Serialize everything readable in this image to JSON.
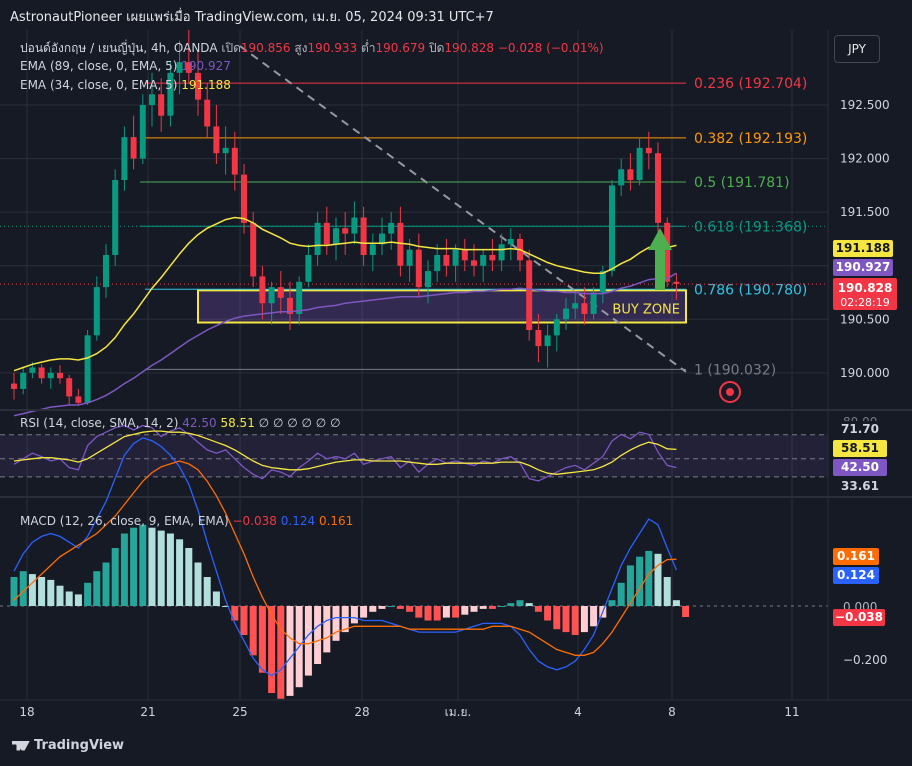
{
  "header": {
    "publisher": "AstronautPioneer เผยแพร่เมื่อ TradingView.com, เม.ย. 05, 2024 09:31 UTC+7"
  },
  "symbol_line": {
    "name": "ปอนด์อังกฤษ / เยนญี่ปุ่น, 4h, OANDA",
    "open_label": "เปิด",
    "open": "190.856",
    "high_label": "สูง",
    "high": "190.933",
    "low_label": "ต่ำ",
    "low": "190.679",
    "close_label": "ปิด",
    "close": "190.828",
    "change": "−0.028 (−0.01%)"
  },
  "ema_legend": [
    {
      "label": "EMA (89, close, 0, EMA, 5)",
      "value": "190.927",
      "color": "#7e57c2"
    },
    {
      "label": "EMA (34, close, 0, EMA, 5)",
      "value": "191.188",
      "color": "#f5e642"
    }
  ],
  "currency_button": "JPY",
  "chart_data": {
    "type": "candlestick",
    "symbol": "GBPJPY",
    "timeframe": "4h",
    "y_axis_ticks": [
      "192.500",
      "192.000",
      "191.500",
      "191.000",
      "190.500",
      "190.000"
    ],
    "x_axis_ticks": [
      "18",
      "21",
      "25",
      "28",
      "เม.ย.",
      "4",
      "8",
      "11"
    ],
    "ylim": [
      189.7,
      193.2
    ],
    "fibonacci": [
      {
        "level": "0.236",
        "price": "192.704",
        "label": "0.236 (192.704)",
        "color": "#f23645"
      },
      {
        "level": "0.382",
        "price": "192.193",
        "label": "0.382 (192.193)",
        "color": "#ff9800"
      },
      {
        "level": "0.5",
        "price": "191.781",
        "label": "0.5 (191.781)",
        "color": "#4caf50"
      },
      {
        "level": "0.618",
        "price": "191.368",
        "label": "0.618 (191.368)",
        "color": "#089981"
      },
      {
        "level": "0.786",
        "price": "190.780",
        "label": "0.786 (190.780)",
        "color": "#2ec4e0"
      },
      {
        "level": "1",
        "price": "190.032",
        "label": "1 (190.032)",
        "color": "#787b86"
      }
    ],
    "buy_zone": {
      "label": "BUY ZONE",
      "top": 190.77,
      "bottom": 190.47,
      "color": "#f5e642"
    },
    "price_tags": [
      {
        "value": "191.188",
        "bg": "#f5e642",
        "fg": "#131722"
      },
      {
        "value": "190.927",
        "bg": "#7e57c2",
        "fg": "#ffffff"
      },
      {
        "value": "190.828",
        "bg": "#f23645",
        "fg": "#ffffff"
      },
      {
        "value": "02:28:19",
        "bg": "#f23645",
        "fg": "#ffffff"
      }
    ],
    "candles_ohlc": [
      [
        189.9,
        190.0,
        189.75,
        189.85
      ],
      [
        189.85,
        190.05,
        189.8,
        190.0
      ],
      [
        190.0,
        190.1,
        189.95,
        190.05
      ],
      [
        190.05,
        190.08,
        189.9,
        189.95
      ],
      [
        189.95,
        190.05,
        189.85,
        190.0
      ],
      [
        190.0,
        190.07,
        189.9,
        189.95
      ],
      [
        189.95,
        189.98,
        189.7,
        189.78
      ],
      [
        189.78,
        189.85,
        189.7,
        189.72
      ],
      [
        189.72,
        190.4,
        189.7,
        190.35
      ],
      [
        190.35,
        190.9,
        190.3,
        190.8
      ],
      [
        190.8,
        191.2,
        190.7,
        191.1
      ],
      [
        191.1,
        191.9,
        191.0,
        191.8
      ],
      [
        191.8,
        192.3,
        191.7,
        192.2
      ],
      [
        192.2,
        192.4,
        191.9,
        192.0
      ],
      [
        192.0,
        192.6,
        191.95,
        192.5
      ],
      [
        192.5,
        192.8,
        192.3,
        192.6
      ],
      [
        192.6,
        192.75,
        192.25,
        192.4
      ],
      [
        192.4,
        192.9,
        192.3,
        192.8
      ],
      [
        192.8,
        193.1,
        192.6,
        192.9
      ],
      [
        192.9,
        193.2,
        192.7,
        192.8
      ],
      [
        192.8,
        193.0,
        192.4,
        192.55
      ],
      [
        192.55,
        192.7,
        192.2,
        192.3
      ],
      [
        192.3,
        192.5,
        191.95,
        192.05
      ],
      [
        192.05,
        192.3,
        191.85,
        192.1
      ],
      [
        192.1,
        192.25,
        191.7,
        191.85
      ],
      [
        191.85,
        191.95,
        191.3,
        191.4
      ],
      [
        191.4,
        191.5,
        190.8,
        190.9
      ],
      [
        190.9,
        191.0,
        190.5,
        190.65
      ],
      [
        190.65,
        190.85,
        190.45,
        190.8
      ],
      [
        190.8,
        190.95,
        190.55,
        190.7
      ],
      [
        190.7,
        190.85,
        190.4,
        190.55
      ],
      [
        190.55,
        190.9,
        190.45,
        190.85
      ],
      [
        190.85,
        191.2,
        190.8,
        191.1
      ],
      [
        191.1,
        191.5,
        191.0,
        191.4
      ],
      [
        191.4,
        191.55,
        191.1,
        191.2
      ],
      [
        191.2,
        191.45,
        191.05,
        191.35
      ],
      [
        191.35,
        191.5,
        191.1,
        191.3
      ],
      [
        191.3,
        191.6,
        191.2,
        191.45
      ],
      [
        191.45,
        191.55,
        191.0,
        191.1
      ],
      [
        191.1,
        191.3,
        190.95,
        191.2
      ],
      [
        191.2,
        191.45,
        191.1,
        191.3
      ],
      [
        191.3,
        191.5,
        191.15,
        191.4
      ],
      [
        191.4,
        191.55,
        190.9,
        191.0
      ],
      [
        191.0,
        191.25,
        190.85,
        191.15
      ],
      [
        191.15,
        191.3,
        190.7,
        190.8
      ],
      [
        190.8,
        191.05,
        190.65,
        190.95
      ],
      [
        190.95,
        191.2,
        190.85,
        191.1
      ],
      [
        191.1,
        191.25,
        190.9,
        191.0
      ],
      [
        191.0,
        191.2,
        190.85,
        191.15
      ],
      [
        191.15,
        191.25,
        190.95,
        191.05
      ],
      [
        191.05,
        191.2,
        190.9,
        191.0
      ],
      [
        191.0,
        191.15,
        190.85,
        191.1
      ],
      [
        191.1,
        191.25,
        190.95,
        191.05
      ],
      [
        191.05,
        191.3,
        190.95,
        191.2
      ],
      [
        191.2,
        191.35,
        191.05,
        191.25
      ],
      [
        191.25,
        191.3,
        190.95,
        191.05
      ],
      [
        191.05,
        191.15,
        190.3,
        190.4
      ],
      [
        190.4,
        190.55,
        190.1,
        190.25
      ],
      [
        190.25,
        190.45,
        190.05,
        190.35
      ],
      [
        190.35,
        190.55,
        190.2,
        190.5
      ],
      [
        190.5,
        190.7,
        190.4,
        190.6
      ],
      [
        190.6,
        190.75,
        190.5,
        190.65
      ],
      [
        190.65,
        190.8,
        190.45,
        190.55
      ],
      [
        190.55,
        190.8,
        190.5,
        190.75
      ],
      [
        190.75,
        191.0,
        190.65,
        190.95
      ],
      [
        190.95,
        191.8,
        190.9,
        191.75
      ],
      [
        191.75,
        192.0,
        191.65,
        191.9
      ],
      [
        191.9,
        192.05,
        191.7,
        191.8
      ],
      [
        191.8,
        192.2,
        191.75,
        192.1
      ],
      [
        192.1,
        192.25,
        191.9,
        192.05
      ],
      [
        192.05,
        192.15,
        191.3,
        191.4
      ],
      [
        191.4,
        191.45,
        190.8,
        190.85
      ],
      [
        190.85,
        190.93,
        190.68,
        190.83
      ]
    ],
    "ema34": [
      190.02,
      190.05,
      190.08,
      190.1,
      190.12,
      190.13,
      190.13,
      190.12,
      190.14,
      190.18,
      190.24,
      190.33,
      190.45,
      190.55,
      190.67,
      190.79,
      190.89,
      191.0,
      191.11,
      191.21,
      191.29,
      191.35,
      191.39,
      191.43,
      191.45,
      191.44,
      191.4,
      191.34,
      191.3,
      191.26,
      191.21,
      191.19,
      191.18,
      191.19,
      191.19,
      191.2,
      191.21,
      191.22,
      191.21,
      191.21,
      191.21,
      191.22,
      191.21,
      191.2,
      191.18,
      191.17,
      191.16,
      191.16,
      191.16,
      191.15,
      191.15,
      191.15,
      191.15,
      191.15,
      191.16,
      191.15,
      191.11,
      191.07,
      191.03,
      191.0,
      190.98,
      190.96,
      190.94,
      190.93,
      190.93,
      190.97,
      191.02,
      191.06,
      191.12,
      191.17,
      191.18,
      191.17,
      191.19
    ],
    "ema89": [
      189.6,
      189.62,
      189.64,
      189.66,
      189.68,
      189.69,
      189.7,
      189.7,
      189.72,
      189.75,
      189.79,
      189.84,
      189.9,
      189.95,
      190.01,
      190.07,
      190.12,
      190.18,
      190.24,
      190.3,
      190.35,
      190.4,
      190.44,
      190.48,
      190.51,
      190.53,
      190.54,
      190.55,
      190.56,
      190.57,
      190.57,
      190.58,
      190.59,
      190.61,
      190.62,
      190.63,
      190.65,
      190.66,
      190.67,
      190.68,
      190.69,
      190.7,
      190.71,
      190.71,
      190.71,
      190.72,
      190.73,
      190.74,
      190.75,
      190.75,
      190.76,
      190.76,
      190.77,
      190.78,
      190.78,
      190.79,
      190.78,
      190.77,
      190.76,
      190.76,
      190.75,
      190.75,
      190.74,
      190.74,
      190.74,
      190.76,
      190.79,
      190.81,
      190.84,
      190.87,
      190.88,
      190.88,
      190.93
    ]
  },
  "rsi": {
    "label": "RSI (14, close, SMA, 14, 2)",
    "rsi_value": "42.50",
    "ma_value": "58.51",
    "extras": [
      "∅",
      "∅",
      "∅",
      "∅",
      "∅",
      "∅"
    ],
    "tags": [
      {
        "value": "71.70",
        "bg": "#161a25",
        "fg": "#d1d4dc"
      },
      {
        "value": "58.51",
        "bg": "#f5e642",
        "fg": "#131722"
      },
      {
        "value": "42.50",
        "bg": "#7e57c2",
        "fg": "#ffffff"
      },
      {
        "value": "33.61",
        "bg": "#161a25",
        "fg": "#d1d4dc"
      }
    ],
    "axis_label": "80.00",
    "rsi_line": [
      45,
      50,
      55,
      52,
      48,
      50,
      42,
      40,
      62,
      70,
      74,
      78,
      80,
      76,
      80,
      78,
      70,
      75,
      78,
      72,
      65,
      58,
      55,
      58,
      50,
      42,
      36,
      32,
      40,
      38,
      34,
      42,
      48,
      55,
      50,
      52,
      50,
      55,
      45,
      48,
      50,
      52,
      42,
      48,
      38,
      45,
      50,
      46,
      48,
      46,
      44,
      48,
      46,
      50,
      52,
      46,
      32,
      30,
      34,
      38,
      42,
      44,
      40,
      46,
      52,
      66,
      72,
      68,
      74,
      72,
      56,
      44,
      42
    ],
    "ma_line": [
      48,
      49,
      50,
      51,
      51,
      50,
      49,
      47,
      50,
      55,
      60,
      65,
      70,
      72,
      74,
      75,
      75,
      74,
      74,
      73,
      71,
      68,
      65,
      62,
      58,
      53,
      48,
      44,
      42,
      41,
      40,
      40,
      41,
      43,
      45,
      47,
      48,
      49,
      49,
      48,
      48,
      48,
      48,
      47,
      46,
      45,
      45,
      46,
      46,
      46,
      46,
      46,
      46,
      47,
      47,
      47,
      44,
      40,
      37,
      36,
      37,
      38,
      39,
      40,
      43,
      47,
      53,
      58,
      62,
      65,
      63,
      59,
      58.5
    ]
  },
  "macd": {
    "label": "MACD (12, 26, close, 9, EMA, EMA)",
    "hist_value": "−0.038",
    "macd_value": "0.124",
    "signal_value": "0.161",
    "tags": [
      {
        "value": "0.161",
        "bg": "#ff6d00",
        "fg": "#ffffff"
      },
      {
        "value": "0.124",
        "bg": "#2962ff",
        "fg": "#ffffff"
      },
      {
        "value": "0.000",
        "bg": "#161a25",
        "fg": "#b2b5be"
      },
      {
        "value": "−0.038",
        "bg": "#f23645",
        "fg": "#ffffff"
      }
    ],
    "axis_ticks": [
      "0.000",
      "−0.200"
    ],
    "histogram": [
      0.1,
      0.12,
      0.11,
      0.1,
      0.09,
      0.07,
      0.05,
      0.04,
      0.08,
      0.12,
      0.15,
      0.2,
      0.25,
      0.27,
      0.28,
      0.27,
      0.26,
      0.25,
      0.23,
      0.2,
      0.15,
      0.1,
      0.05,
      0.0,
      -0.05,
      -0.1,
      -0.17,
      -0.23,
      -0.3,
      -0.32,
      -0.31,
      -0.28,
      -0.24,
      -0.2,
      -0.16,
      -0.12,
      -0.09,
      -0.06,
      -0.04,
      -0.02,
      -0.01,
      0.0,
      -0.01,
      -0.02,
      -0.04,
      -0.05,
      -0.05,
      -0.04,
      -0.04,
      -0.03,
      -0.02,
      -0.01,
      -0.01,
      0.0,
      0.01,
      0.02,
      0.01,
      -0.02,
      -0.05,
      -0.08,
      -0.09,
      -0.1,
      -0.09,
      -0.07,
      -0.04,
      0.02,
      0.08,
      0.14,
      0.17,
      0.19,
      0.18,
      0.1,
      0.02,
      -0.038
    ],
    "macd_line": [
      0.12,
      0.18,
      0.22,
      0.24,
      0.25,
      0.24,
      0.22,
      0.2,
      0.24,
      0.3,
      0.36,
      0.44,
      0.52,
      0.56,
      0.58,
      0.57,
      0.55,
      0.52,
      0.48,
      0.42,
      0.33,
      0.22,
      0.12,
      0.02,
      -0.06,
      -0.12,
      -0.18,
      -0.22,
      -0.24,
      -0.22,
      -0.18,
      -0.14,
      -0.1,
      -0.07,
      -0.05,
      -0.04,
      -0.04,
      -0.04,
      -0.05,
      -0.05,
      -0.05,
      -0.06,
      -0.07,
      -0.08,
      -0.09,
      -0.09,
      -0.09,
      -0.09,
      -0.09,
      -0.08,
      -0.07,
      -0.06,
      -0.06,
      -0.06,
      -0.07,
      -0.1,
      -0.15,
      -0.19,
      -0.21,
      -0.22,
      -0.21,
      -0.19,
      -0.15,
      -0.1,
      -0.02,
      0.06,
      0.14,
      0.2,
      0.25,
      0.3,
      0.28,
      0.2,
      0.124
    ],
    "signal_line": [
      0.02,
      0.05,
      0.08,
      0.11,
      0.14,
      0.17,
      0.19,
      0.21,
      0.23,
      0.25,
      0.28,
      0.31,
      0.35,
      0.39,
      0.43,
      0.46,
      0.48,
      0.49,
      0.5,
      0.49,
      0.47,
      0.43,
      0.38,
      0.32,
      0.25,
      0.18,
      0.1,
      0.03,
      -0.03,
      -0.08,
      -0.11,
      -0.13,
      -0.13,
      -0.12,
      -0.11,
      -0.09,
      -0.08,
      -0.07,
      -0.07,
      -0.07,
      -0.07,
      -0.07,
      -0.07,
      -0.08,
      -0.08,
      -0.08,
      -0.08,
      -0.08,
      -0.08,
      -0.08,
      -0.08,
      -0.08,
      -0.07,
      -0.07,
      -0.07,
      -0.08,
      -0.09,
      -0.11,
      -0.13,
      -0.15,
      -0.16,
      -0.17,
      -0.17,
      -0.16,
      -0.13,
      -0.09,
      -0.04,
      0.01,
      0.06,
      0.11,
      0.14,
      0.16,
      0.161
    ]
  },
  "footer": {
    "brand": "TradingView"
  },
  "colors": {
    "bg": "#161a25",
    "up": "#089981",
    "down": "#f23645",
    "grid": "#2a2e39"
  }
}
